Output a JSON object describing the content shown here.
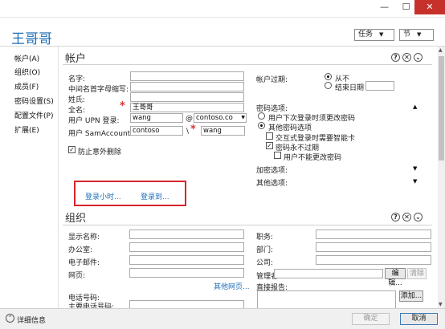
{
  "window": {
    "minimize_glyph": "—",
    "maximize_glyph": "☐",
    "close_glyph": "✕"
  },
  "header": {
    "title": "王哥哥",
    "tasks_label": "任务",
    "sections_label": "节"
  },
  "nav": {
    "items": [
      "帐户(A)",
      "组织(O)",
      "成员(F)",
      "密码设置(S)",
      "配置文件(P)",
      "扩展(E)"
    ]
  },
  "account": {
    "title": "帐户",
    "labels": {
      "first_name": "名字:",
      "initials": "中间名首字母缩写:",
      "last_name": "姓氏:",
      "full_name": "全名:",
      "upn": "用户 UPN 登录:",
      "sam": "用户 SamAccount...",
      "protect": "防止意外删除"
    },
    "values": {
      "first_name": "",
      "initials": "",
      "last_name": "",
      "full_name": "王哥哥",
      "upn_user": "wang",
      "upn_at": "@",
      "upn_domain": "contoso.co",
      "sam_domain": "contoso",
      "sam_sep": "\\",
      "sam_user": "wang"
    },
    "logon_hours_link": "登录小时...",
    "logon_to_link": "登录到...",
    "expiry": {
      "label": "帐户过期:",
      "never": "从不",
      "end_of": "结束日期",
      "end_value": ""
    },
    "password_options": {
      "label": "密码选项:",
      "must_change": "用户下次登录时须更改密码",
      "other": "其他密码选项",
      "smart_card": "交互式登录时需要智能卡",
      "never_expires": "密码永不过期",
      "cannot_change": "用户不能更改密码"
    },
    "encryption_label": "加密选项:",
    "other_label": "其他选项:"
  },
  "organization": {
    "title": "组织",
    "labels": {
      "display_name": "显示名称:",
      "office": "办公室:",
      "email": "电子邮件:",
      "web": "网页:",
      "phones": "电话号码:",
      "main_phone": "主要电话号码:",
      "job_title": "职务:",
      "department": "部门:",
      "company": "公司:",
      "manager": "管理者:",
      "direct_reports": "直接报告:"
    },
    "values": {
      "display_name": "",
      "office": "",
      "email": "",
      "web": "",
      "main_phone": "",
      "job_title": "",
      "department": "",
      "company": "",
      "manager": ""
    },
    "other_web_link": "其他网页...",
    "edit_button": "编辑...",
    "clear_button": "清除",
    "add_button": "添加..."
  },
  "section_icons": {
    "help": "?",
    "collapse": "✕",
    "more": "⌄"
  },
  "footer": {
    "more_info": "详细信息",
    "ok": "确定",
    "cancel": "取消"
  },
  "colors": {
    "title_blue": "#1f6fb8",
    "required_star": "#d13438",
    "highlight_box": "#d8262c",
    "close_red": "#c7312b"
  }
}
